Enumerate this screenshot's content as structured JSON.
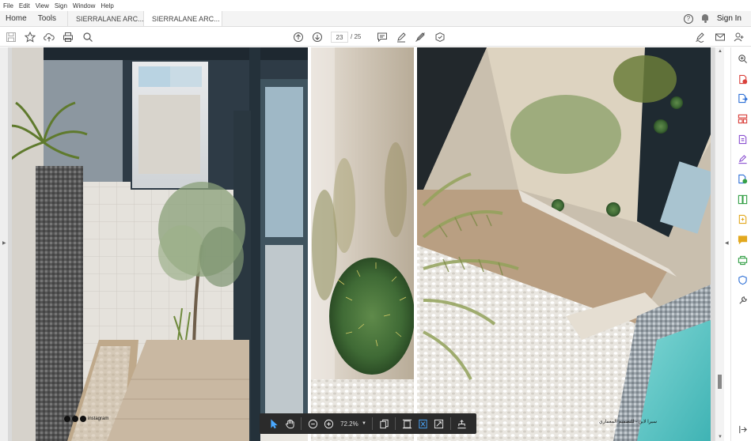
{
  "menu": {
    "items": [
      "File",
      "Edit",
      "View",
      "Sign",
      "Window",
      "Help"
    ]
  },
  "tabs": {
    "home": "Home",
    "tools": "Tools",
    "documents": [
      {
        "label": "SIERRALANE ARC...",
        "active": false
      },
      {
        "label": "SIERRALANE ARC...",
        "active": true,
        "close": "×"
      }
    ],
    "sign_in": "Sign In"
  },
  "toolbar": {
    "current_page": "23",
    "total_pages": "/ 25"
  },
  "zoombar": {
    "zoom": "72.2%"
  },
  "document": {
    "watermark_left": "instagram",
    "watermark_right": "سيرا لاين - للتصميم المعماري"
  },
  "colors": {
    "accent": "#4aa8ff",
    "rightbar_red": "#d9403b",
    "rightbar_blue": "#2d6fd6",
    "rightbar_purple": "#8a4fd0",
    "rightbar_green": "#35a047",
    "rightbar_yellow": "#e2a81e"
  }
}
